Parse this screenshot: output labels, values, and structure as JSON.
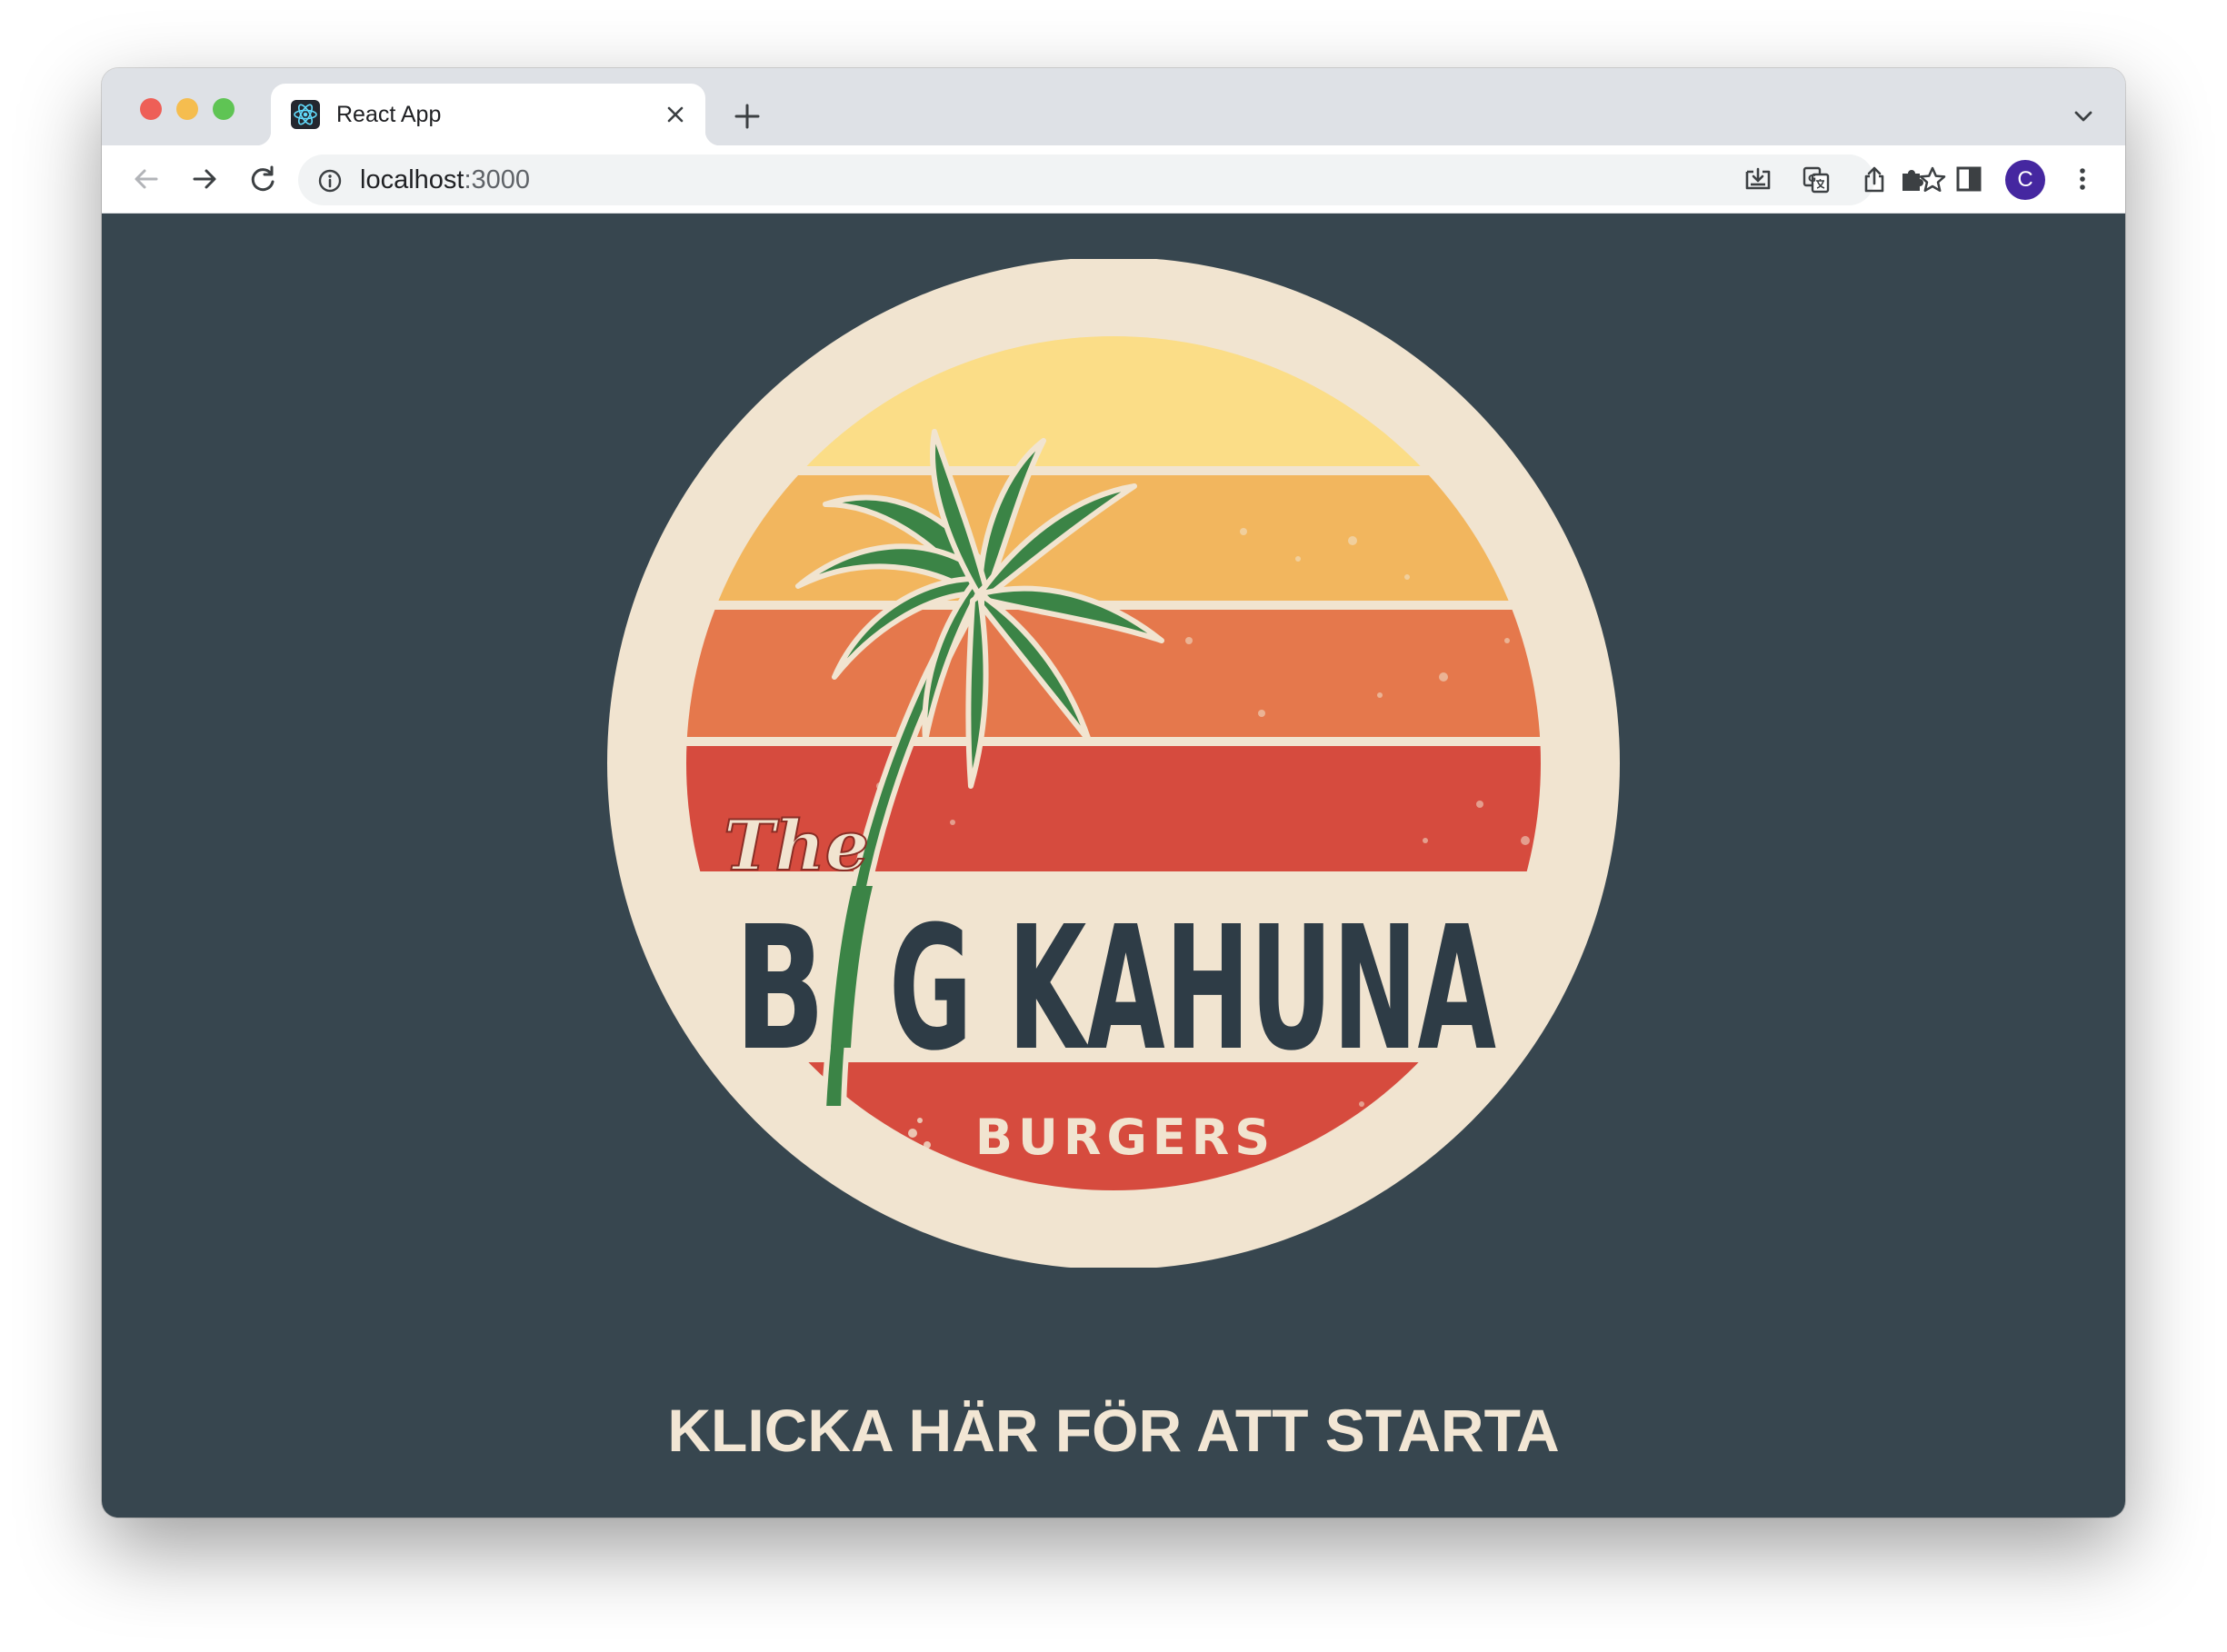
{
  "browser": {
    "tab": {
      "title": "React App",
      "favicon": "react-logo-icon"
    },
    "address": {
      "host": "localhost",
      "port": ":3000"
    },
    "profile": {
      "initial": "C",
      "color": "#4527a0"
    },
    "icons": [
      "back-arrow-icon",
      "forward-arrow-icon",
      "reload-icon",
      "info-icon",
      "install-app-icon",
      "translate-icon",
      "share-icon",
      "bookmark-star-icon",
      "extensions-puzzle-icon",
      "side-panel-icon",
      "kebab-menu-icon",
      "new-tab-plus-icon",
      "tab-close-icon",
      "tab-search-chevron-icon"
    ]
  },
  "page": {
    "background": "#37464f",
    "logo": {
      "script_word": "The",
      "title_left": "B",
      "title_right": "G KAHUNA",
      "subtitle": "BURGERS",
      "colors": {
        "cream": "#f1e4d0",
        "yellow": "#fbdd87",
        "orange_light": "#f2b65e",
        "orange": "#e5784c",
        "red": "#d64b3e",
        "palm_green": "#3b8446",
        "letters": "#2e3c46"
      }
    },
    "start_label": "KLICKA HÄR FÖR ATT STARTA"
  }
}
